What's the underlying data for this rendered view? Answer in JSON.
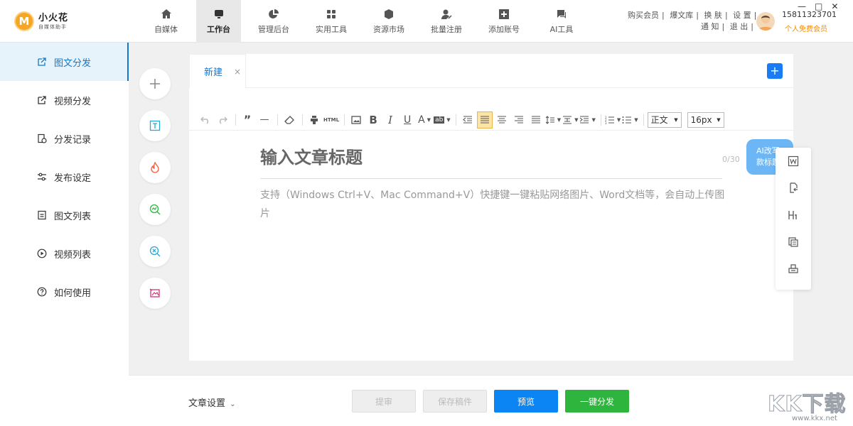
{
  "app": {
    "name": "小火花",
    "subtitle": "自媒体助手",
    "logo_letter": "M"
  },
  "nav": [
    {
      "label": "自媒体",
      "icon": "home-icon"
    },
    {
      "label": "工作台",
      "icon": "monitor-icon",
      "active": true
    },
    {
      "label": "管理后台",
      "icon": "pie-chart-icon"
    },
    {
      "label": "实用工具",
      "icon": "grid-icon"
    },
    {
      "label": "资源市场",
      "icon": "cube-icon"
    },
    {
      "label": "批量注册",
      "icon": "user-edit-icon"
    },
    {
      "label": "添加账号",
      "icon": "plus-square-icon"
    },
    {
      "label": "AI工具",
      "icon": "chat-icon"
    }
  ],
  "top_links": {
    "row1": [
      "购买会员",
      "|",
      "爆文库",
      "|",
      "换 肤",
      "|",
      "设 置",
      "|"
    ],
    "row2": [
      "通 知",
      "|",
      "退 出",
      "|"
    ]
  },
  "user": {
    "phone": "15811323701",
    "member": "个人免费会员"
  },
  "sidebar": [
    {
      "label": "图文分发",
      "icon": "share-doc-icon",
      "active": true
    },
    {
      "label": "视频分发",
      "icon": "share-video-icon"
    },
    {
      "label": "分发记录",
      "icon": "record-icon"
    },
    {
      "label": "发布设定",
      "icon": "sliders-icon"
    },
    {
      "label": "图文列表",
      "icon": "list-doc-icon"
    },
    {
      "label": "视频列表",
      "icon": "play-circle-icon"
    },
    {
      "label": "如何使用",
      "icon": "help-icon"
    }
  ],
  "tool_buttons": [
    {
      "name": "add-icon",
      "color": "#888888"
    },
    {
      "name": "text-box-icon",
      "color": "#2aa7d8"
    },
    {
      "name": "fire-icon",
      "color": "#f05a3a"
    },
    {
      "name": "search-chart-icon",
      "color": "#2db53e"
    },
    {
      "name": "search-x-icon",
      "color": "#2aa7d8"
    },
    {
      "name": "image-edit-icon",
      "color": "#d6337a"
    }
  ],
  "editor": {
    "tab_label": "新建",
    "tab_close": "×",
    "add_tab": "+",
    "title_placeholder": "输入文章标题",
    "title_count": "0/30",
    "body_placeholder": "支持（Windows Ctrl+V、Mac Command+V）快捷键一键粘贴网络图片、Word文档等，会自动上传图片",
    "toolbar_text": {
      "html": "HTML",
      "bold": "B",
      "italic": "I",
      "underline": "U",
      "font_color": "A",
      "highlight": "ab"
    },
    "paragraph": "正文",
    "font_size": "16px"
  },
  "ai_bubble": {
    "line1": "AI改写",
    "line2": "款标题"
  },
  "side_tools": [
    "word-icon",
    "import-icon",
    "heading-icon",
    "copy-icon",
    "stamp-icon"
  ],
  "footer": {
    "settings_label": "文章设置",
    "buttons": {
      "submit": "提审",
      "save_draft": "保存稿件",
      "preview": "预览",
      "publish": "一键分发"
    }
  },
  "watermark": {
    "big": "KK下载",
    "small": "www.kkx.net"
  },
  "colors": {
    "accent": "#1677c9",
    "preview_blue": "#0b84f4",
    "publish_green": "#2db53e",
    "member_orange": "#f08c00"
  }
}
